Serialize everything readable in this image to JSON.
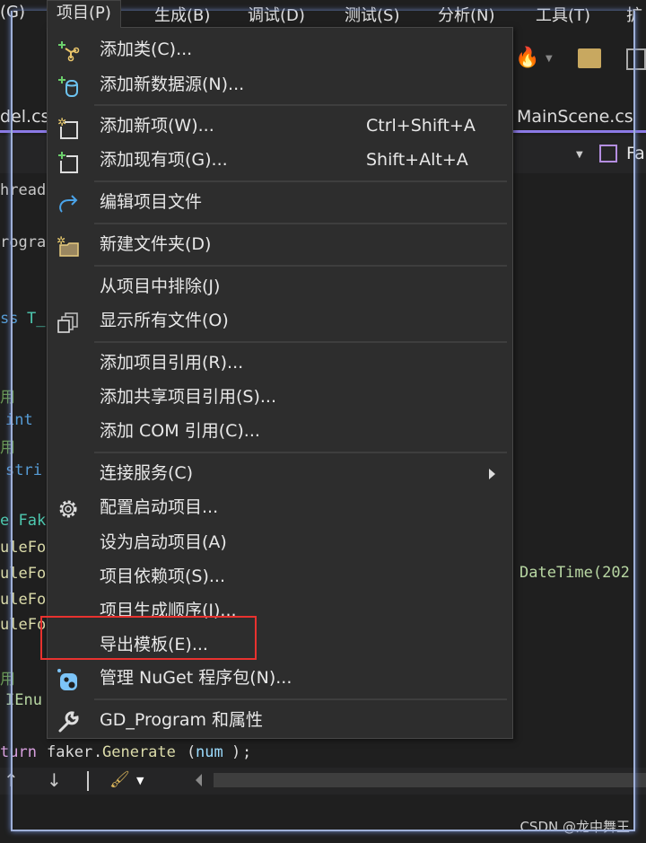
{
  "menubar": {
    "items": [
      "(G)",
      "项目(P)",
      "生成(B)",
      "调试(D)",
      "测试(S)",
      "分析(N)",
      "工具(T)",
      "扩"
    ]
  },
  "tabs": {
    "left": "del.cs",
    "right": "MainScene.cs"
  },
  "navbar": {
    "right_label": "Fa"
  },
  "code_fragments": [
    "hread",
    "rogra",
    "ss",
    "T_",
    "用",
    "int",
    "用",
    "stri",
    "e Fak",
    "uleFo",
    "uleFo",
    "uleFo",
    "uleFo",
    "用",
    "IEnu",
    "DateTime(202",
    "turn",
    "faker",
    "Generate",
    "num",
    ";"
  ],
  "menu": {
    "items": [
      {
        "label": "添加类(C)...",
        "icon": "add-class-icon"
      },
      {
        "label": "添加新数据源(N)...",
        "icon": "add-datasource-icon"
      },
      {
        "label": "添加新项(W)...",
        "shortcut": "Ctrl+Shift+A",
        "icon": "add-new-item-icon"
      },
      {
        "label": "添加现有项(G)...",
        "shortcut": "Shift+Alt+A",
        "icon": "add-existing-item-icon"
      },
      {
        "label": "编辑项目文件",
        "icon": "redo-arrow-icon"
      },
      {
        "label": "新建文件夹(D)",
        "icon": "new-folder-icon"
      },
      {
        "label": "从项目中排除(J)"
      },
      {
        "label": "显示所有文件(O)",
        "icon": "show-all-files-icon"
      },
      {
        "label": "添加项目引用(R)..."
      },
      {
        "label": "添加共享项目引用(S)..."
      },
      {
        "label": "添加 COM 引用(C)..."
      },
      {
        "label": "连接服务(C)",
        "submenu": true
      },
      {
        "label": "配置启动项目...",
        "icon": "gear-icon"
      },
      {
        "label": "设为启动项目(A)"
      },
      {
        "label": "项目依赖项(S)..."
      },
      {
        "label": "项目生成顺序(I)..."
      },
      {
        "label": "导出模板(E)...",
        "highlighted": true
      },
      {
        "label": "管理 NuGet 程序包(N)...",
        "icon": "nuget-icon"
      },
      {
        "label": "GD_Program 和属性",
        "icon": "wrench-icon"
      }
    ]
  },
  "colors": {
    "highlight_box": "#e8322f",
    "tab_accent": "#8c7ae6",
    "menu_bg": "#2d2d2d"
  },
  "watermark": "CSDN @龙中舞王"
}
